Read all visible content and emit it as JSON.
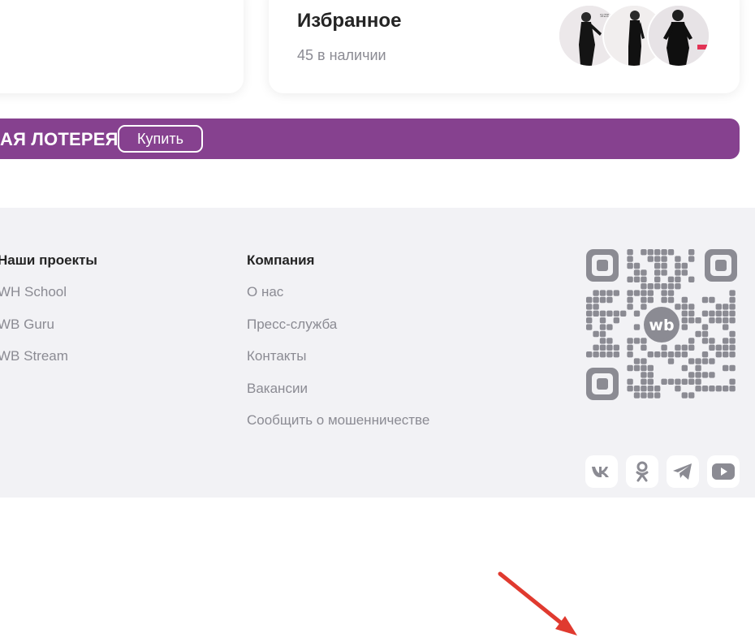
{
  "favorites": {
    "title": "Избранное",
    "count_text": "45 в наличии"
  },
  "lottery": {
    "title": "АЯ ЛОТЕРЕЯ",
    "buy_label": "Купить",
    "color": "#86418f"
  },
  "footer": {
    "projects": {
      "heading": "Наши проекты",
      "links": [
        "WH School",
        "WB Guru",
        "WB Stream"
      ]
    },
    "company": {
      "heading": "Компания",
      "links": [
        "О нас",
        "Пресс-служба",
        "Контакты",
        "Вакансии",
        "Сообщить о мошенничестве"
      ]
    },
    "qr": {
      "logo_text": "wb"
    },
    "social": [
      "vk-icon",
      "odnoklassniki-icon",
      "telegram-icon",
      "youtube-icon"
    ]
  }
}
